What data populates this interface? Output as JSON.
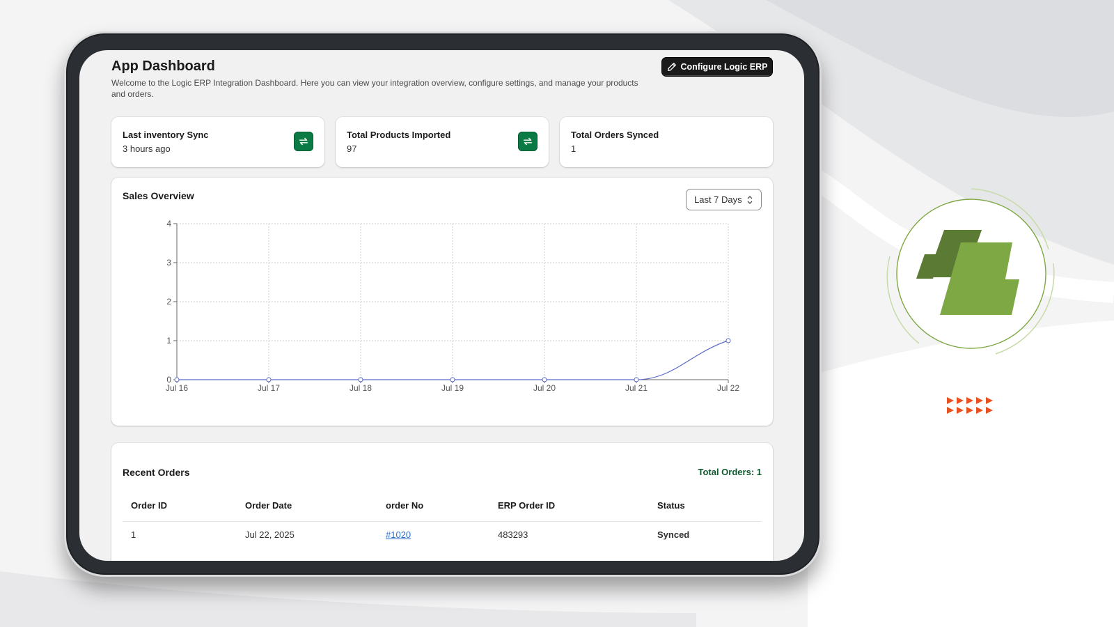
{
  "header": {
    "title": "App Dashboard",
    "description": "Welcome to the Logic ERP Integration Dashboard. Here you can view your integration overview, configure settings, and manage your products and orders.",
    "configure_button": "Configure Logic ERP"
  },
  "stats": [
    {
      "label": "Last inventory Sync",
      "value": "3 hours ago",
      "icon": "sync-icon"
    },
    {
      "label": "Total Products Imported",
      "value": "97",
      "icon": "sync-icon"
    },
    {
      "label": "Total Orders Synced",
      "value": "1"
    }
  ],
  "sales": {
    "title": "Sales Overview",
    "range_selected": "Last 7 Days"
  },
  "chart_data": {
    "type": "line",
    "categories": [
      "Jul 16",
      "Jul 17",
      "Jul 18",
      "Jul 19",
      "Jul 20",
      "Jul 21",
      "Jul 22"
    ],
    "series": [
      {
        "values": [
          0,
          0,
          0,
          0,
          0,
          0,
          1
        ]
      }
    ],
    "ylim": [
      0,
      4
    ],
    "yticks": [
      0,
      1,
      2,
      3,
      4
    ],
    "grid": true,
    "line_color": "#5c6ac4"
  },
  "orders": {
    "title": "Recent Orders",
    "total": "Total Orders: 1",
    "columns": [
      "Order ID",
      "Order Date",
      "order No",
      "ERP Order ID",
      "Status"
    ],
    "rows": [
      {
        "order_id": "1",
        "order_date": "Jul 22, 2025",
        "order_no": "#1020",
        "erp_order_id": "483293",
        "status": "Synced"
      }
    ]
  },
  "colors": {
    "brand_green": "#7ea843",
    "brand_dark_green": "#5b7a33",
    "accent_orange": "#e8501f",
    "status_green": "#0f5a2e"
  }
}
